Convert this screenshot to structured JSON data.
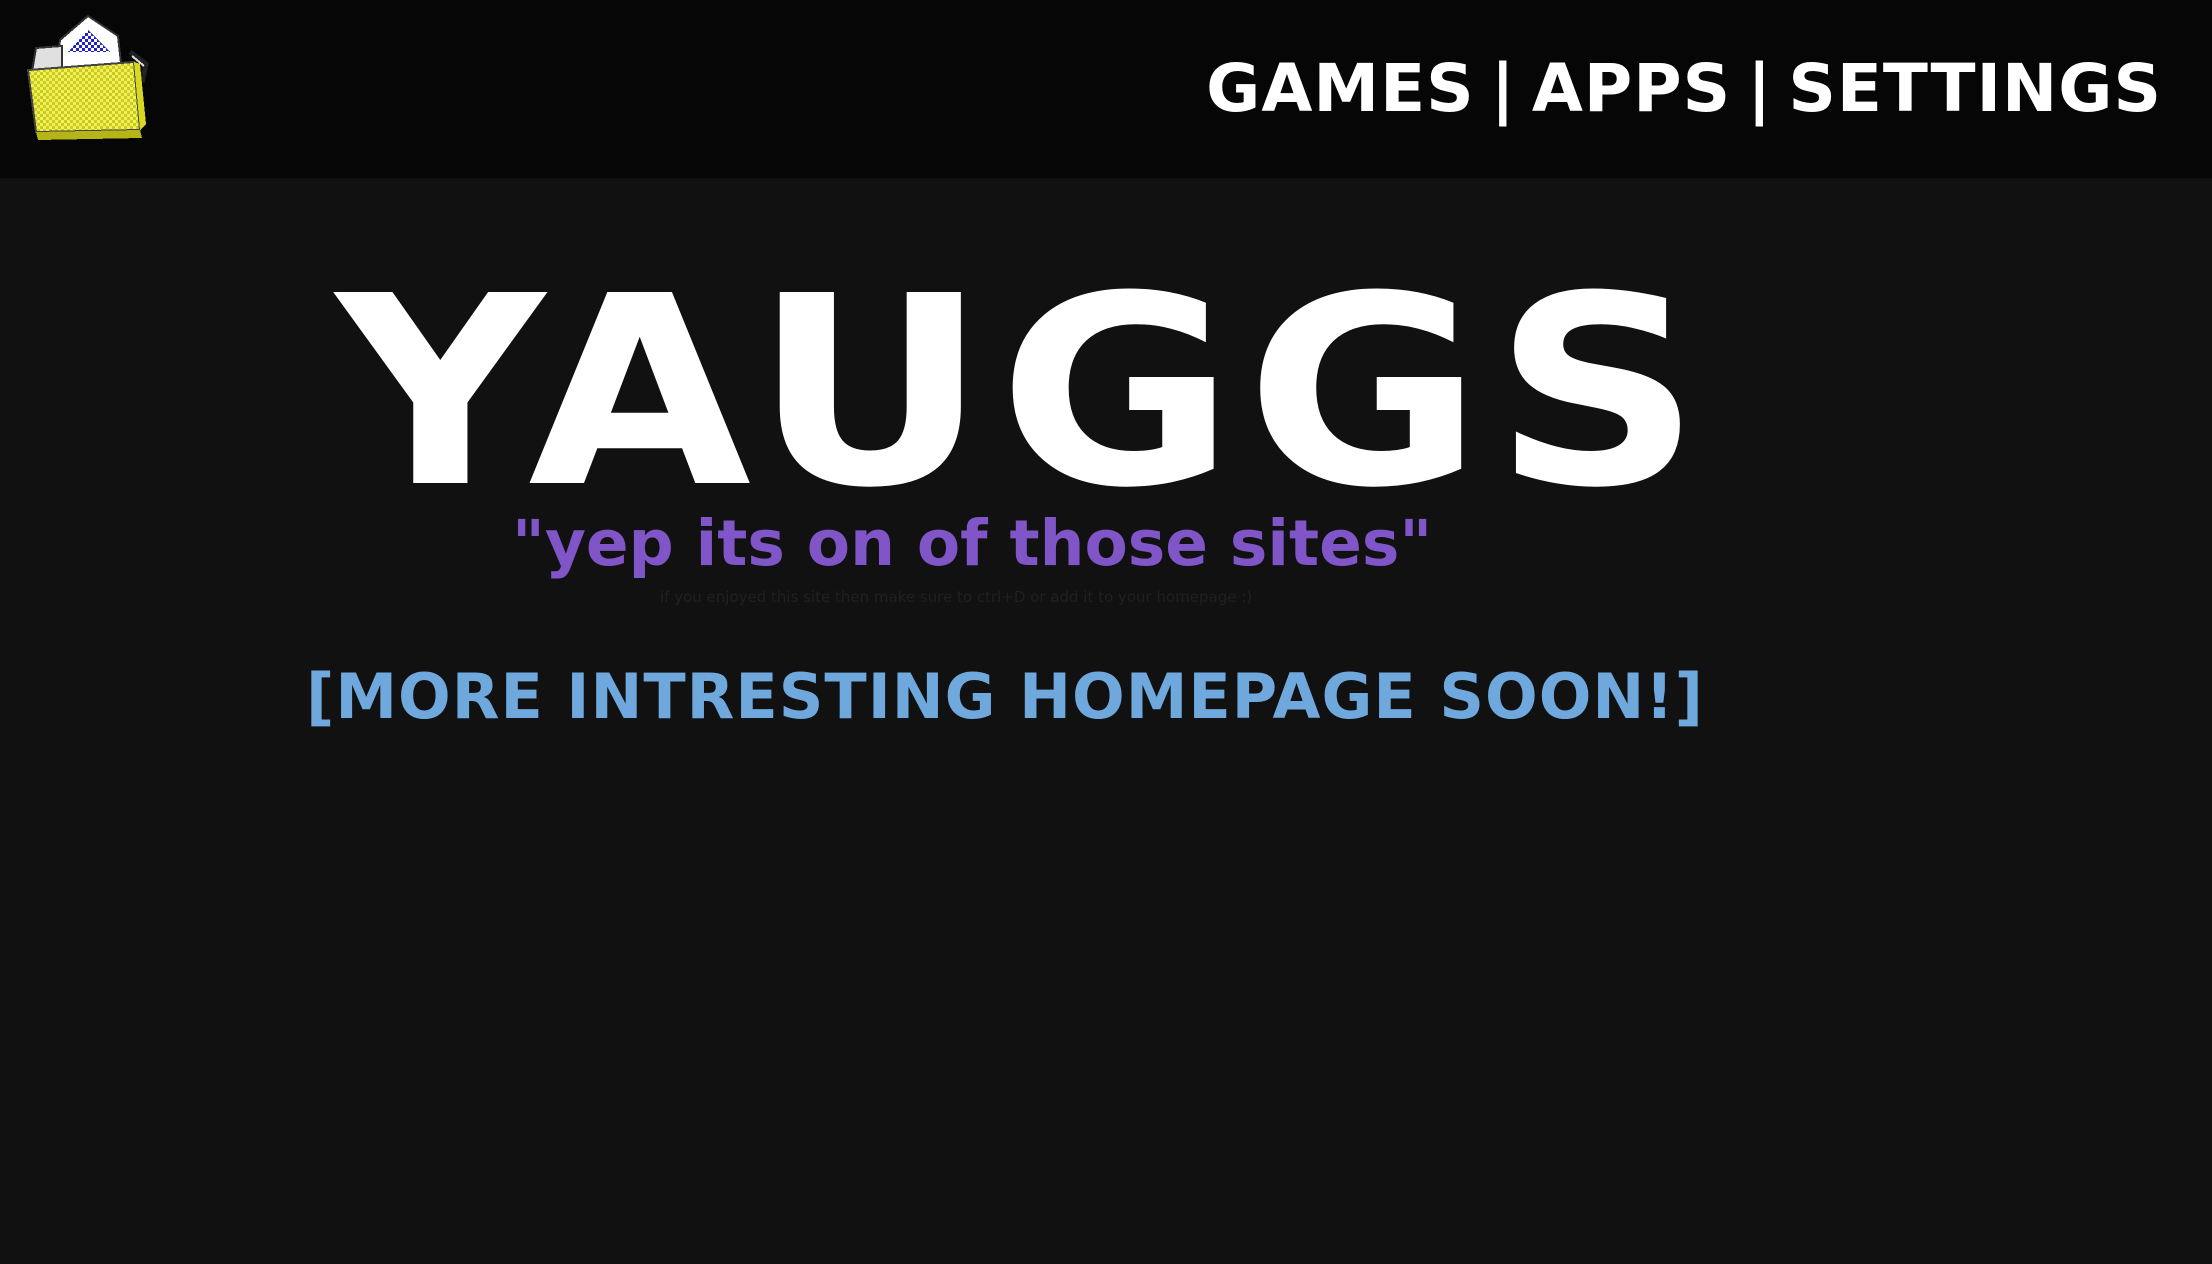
{
  "header": {
    "logo_icon": "basket-folder-icon",
    "nav": [
      {
        "label": "GAMES"
      },
      {
        "label": "APPS"
      },
      {
        "label": "SETTINGS"
      }
    ],
    "separator": "|"
  },
  "main": {
    "title": "YAUGGS",
    "tagline": "\"yep its on of those sites\"",
    "note": "if you enjoyed this site then make sure to ctrl+D or add it to your homepage :)",
    "announcement": "[MORE INTRESTING HOMEPAGE SOON!]"
  },
  "colors": {
    "background": "#111111",
    "header_background": "#060606",
    "title": "#ffffff",
    "tagline": "#7f55c7",
    "announcement": "#6ea8dc"
  }
}
